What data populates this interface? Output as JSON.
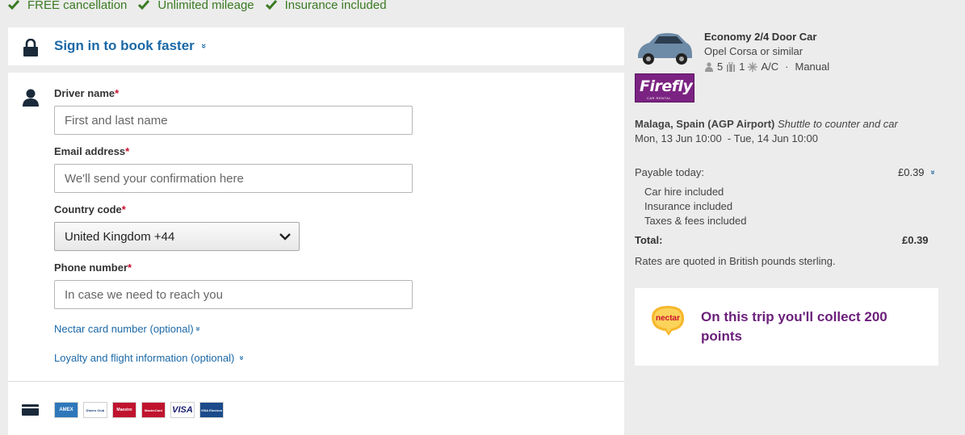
{
  "benefits": [
    "FREE cancellation",
    "Unlimited mileage",
    "Insurance included"
  ],
  "signin": {
    "label": "Sign in to book faster",
    "chevron": "»"
  },
  "form": {
    "driver": {
      "label": "Driver name",
      "req": "*",
      "placeholder": "First and last name"
    },
    "email": {
      "label": "Email address",
      "req": "*",
      "placeholder": "We'll send your confirmation here"
    },
    "country": {
      "label": "Country code",
      "req": "*",
      "value": "United Kingdom +44"
    },
    "phone": {
      "label": "Phone number",
      "req": "*",
      "placeholder": "In case we need to reach you"
    },
    "nectar_link": "Nectar card number (optional)",
    "loyalty_link": "Loyalty and flight information (optional)",
    "chevron": "»",
    "cards": [
      "AMEX",
      "Diners Club",
      "Maestro",
      "MasterCard",
      "VISA",
      "VISA Electron"
    ]
  },
  "car": {
    "title": "Economy 2/4 Door Car",
    "model": "Opel Corsa or similar",
    "passengers": "5",
    "bags": "1",
    "ac": "A/C",
    "sep": "·",
    "transmission": "Manual",
    "supplier": "Firefly",
    "supplier_tag": "CAR RENTAL"
  },
  "trip": {
    "location": "Malaga, Spain (AGP Airport)",
    "shuttle": "Shuttle to counter and car",
    "dates": "Mon, 13 Jun 10:00  - Tue, 14 Jun 10:00"
  },
  "price": {
    "payable_label": "Payable today:",
    "payable_value": "£0.39",
    "chevron": "»",
    "included": [
      "Car hire included",
      "Insurance included",
      "Taxes & fees included"
    ],
    "total_label": "Total:",
    "total_value": "£0.39",
    "rates_note": "Rates are quoted in British pounds sterling."
  },
  "nectar": {
    "logo_text": "nectar",
    "message": "On this trip you'll collect 200 points"
  },
  "colors": {
    "link": "#1b68a6",
    "check": "#3a7a23",
    "nectar_purple": "#6b1f7a",
    "firefly": "#7b2382",
    "required": "#c8102e"
  }
}
